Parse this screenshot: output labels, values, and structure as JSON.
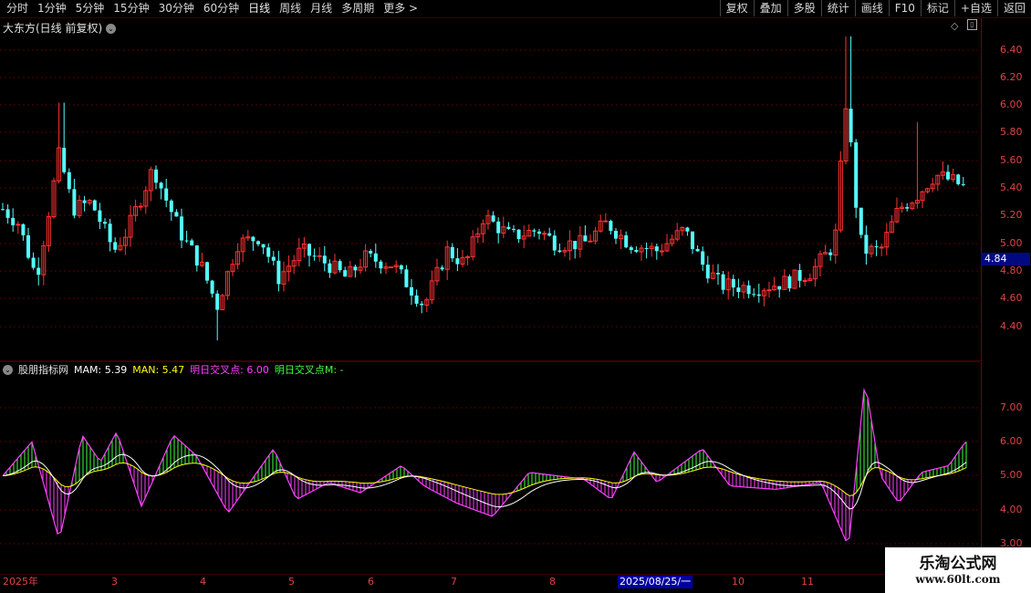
{
  "toolbar": {
    "periods": [
      "分时",
      "1分钟",
      "5分钟",
      "15分钟",
      "30分钟",
      "60分钟",
      "日线",
      "周线",
      "月线",
      "多周期",
      "更多 >"
    ],
    "active_period": "日线",
    "buttons": [
      "复权",
      "叠加",
      "多股",
      "统计",
      "画线",
      "F10",
      "标记",
      "+自选",
      "返回"
    ]
  },
  "main_pane": {
    "title": "大东方(日线 前复权)",
    "current_price": "4.84",
    "y_ticks": [
      "6.40",
      "6.20",
      "6.00",
      "5.80",
      "5.60",
      "5.40",
      "5.20",
      "5.00",
      "4.80",
      "4.60",
      "4.40"
    ]
  },
  "sub_pane": {
    "indicator_name": "股朋指标网",
    "mam_label": "MAM: 5.39",
    "man_label": "MAN: 5.47",
    "cross_label": "明日交叉点: 6.00",
    "cross_m_label": "明日交叉点M: -",
    "y_ticks": [
      "7.00",
      "6.00",
      "5.00",
      "4.00",
      "3.00"
    ]
  },
  "date_axis": {
    "labels": [
      "2025年",
      "3",
      "4",
      "5",
      "6",
      "7",
      "8",
      "10",
      "11",
      "1"
    ],
    "cursor_label": "2025/08/25/一"
  },
  "watermark": {
    "title": "乐淘公式网",
    "url": "www.60lt.com"
  },
  "colors": {
    "up": "#ff3232",
    "down": "#54ffff",
    "mam": "#ffffff",
    "man": "#ffff00",
    "cross": "#ff40ff",
    "cross_m": "#40ff40",
    "grid": "#7a0000"
  },
  "chart_data": {
    "type": "candlestick",
    "price_range": [
      4.3,
      6.55
    ],
    "indicator_range": [
      2.9,
      8.0
    ]
  }
}
